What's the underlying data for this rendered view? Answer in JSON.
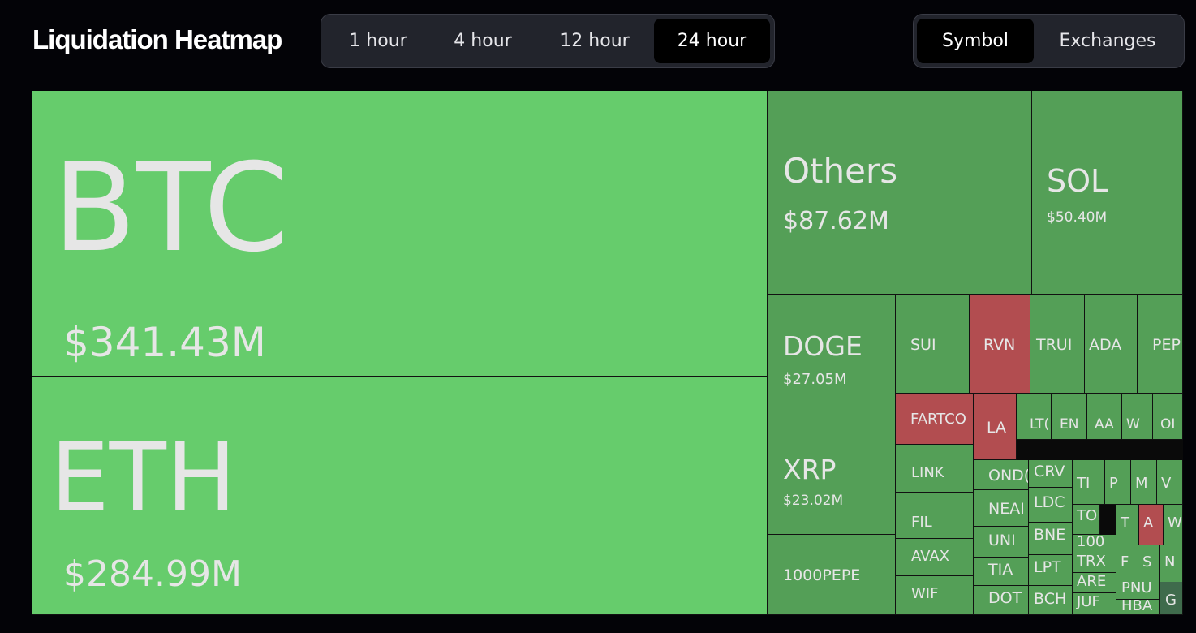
{
  "header": {
    "title": "Liquidation Heatmap",
    "time_ranges": [
      "1 hour",
      "4 hour",
      "12 hour",
      "24 hour"
    ],
    "selected_time_range": "24 hour",
    "groupings": [
      "Symbol",
      "Exchanges"
    ],
    "selected_grouping": "Symbol"
  },
  "colors": {
    "background": "#030307",
    "major_green": "#66cc6c",
    "green": "#549f57",
    "red": "#b24d50",
    "dark": "#3f6b4c",
    "text": "#e6e6e6"
  },
  "heatmap": {
    "tiles": [
      {
        "symbol": "BTC",
        "value": "$341.43M",
        "color": "major_green"
      },
      {
        "symbol": "ETH",
        "value": "$284.99M",
        "color": "major_green"
      },
      {
        "symbol": "Others",
        "value": "$87.62M",
        "color": "green"
      },
      {
        "symbol": "SOL",
        "value": "$50.40M",
        "color": "green"
      },
      {
        "symbol": "DOGE",
        "value": "$27.05M",
        "color": "green"
      },
      {
        "symbol": "XRP",
        "value": "$23.02M",
        "color": "green"
      },
      {
        "symbol": "1000PEPE",
        "value": "",
        "color": "green"
      },
      {
        "symbol": "SUI",
        "value": "",
        "color": "green"
      },
      {
        "symbol": "RVN",
        "value": "",
        "color": "red"
      },
      {
        "symbol": "TRUI",
        "value": "",
        "color": "green"
      },
      {
        "symbol": "ADA",
        "value": "",
        "color": "green"
      },
      {
        "symbol": "PEP",
        "value": "",
        "color": "green"
      },
      {
        "symbol": "FARTCO",
        "value": "",
        "color": "red"
      },
      {
        "symbol": "LA",
        "value": "",
        "color": "red"
      },
      {
        "symbol": "LT(",
        "value": "",
        "color": "green"
      },
      {
        "symbol": "EN",
        "value": "",
        "color": "green"
      },
      {
        "symbol": "AA",
        "value": "",
        "color": "green"
      },
      {
        "symbol": "W",
        "value": "",
        "color": "green"
      },
      {
        "symbol": "OI",
        "value": "",
        "color": "green"
      },
      {
        "symbol": "LINK",
        "value": "",
        "color": "green"
      },
      {
        "symbol": "FIL",
        "value": "",
        "color": "green"
      },
      {
        "symbol": "AVAX",
        "value": "",
        "color": "green"
      },
      {
        "symbol": "WIF",
        "value": "",
        "color": "green"
      },
      {
        "symbol": "OND(",
        "value": "",
        "color": "green"
      },
      {
        "symbol": "NEAI",
        "value": "",
        "color": "green"
      },
      {
        "symbol": "UNI",
        "value": "",
        "color": "green"
      },
      {
        "symbol": "TIA",
        "value": "",
        "color": "green"
      },
      {
        "symbol": "DOT",
        "value": "",
        "color": "green"
      },
      {
        "symbol": "CRV",
        "value": "",
        "color": "green"
      },
      {
        "symbol": "LDC",
        "value": "",
        "color": "green"
      },
      {
        "symbol": "BNE",
        "value": "",
        "color": "green"
      },
      {
        "symbol": "LPT",
        "value": "",
        "color": "green"
      },
      {
        "symbol": "BCH",
        "value": "",
        "color": "green"
      },
      {
        "symbol": "TI",
        "value": "",
        "color": "green"
      },
      {
        "symbol": "P",
        "value": "",
        "color": "green"
      },
      {
        "symbol": "M",
        "value": "",
        "color": "green"
      },
      {
        "symbol": "V",
        "value": "",
        "color": "green"
      },
      {
        "symbol": "TON",
        "value": "",
        "color": "green"
      },
      {
        "symbol": "T",
        "value": "",
        "color": "green"
      },
      {
        "symbol": "A",
        "value": "",
        "color": "red"
      },
      {
        "symbol": "W",
        "value": "",
        "color": "green"
      },
      {
        "symbol": "100",
        "value": "",
        "color": "green"
      },
      {
        "symbol": "TRX",
        "value": "",
        "color": "green"
      },
      {
        "symbol": "F",
        "value": "",
        "color": "green"
      },
      {
        "symbol": "S",
        "value": "",
        "color": "green"
      },
      {
        "symbol": "N",
        "value": "",
        "color": "green"
      },
      {
        "symbol": "ARE",
        "value": "",
        "color": "green"
      },
      {
        "symbol": "PNU",
        "value": "",
        "color": "green"
      },
      {
        "symbol": "JUF",
        "value": "",
        "color": "green"
      },
      {
        "symbol": "HBA",
        "value": "",
        "color": "green"
      },
      {
        "symbol": "G",
        "value": "",
        "color": "dark"
      }
    ]
  }
}
